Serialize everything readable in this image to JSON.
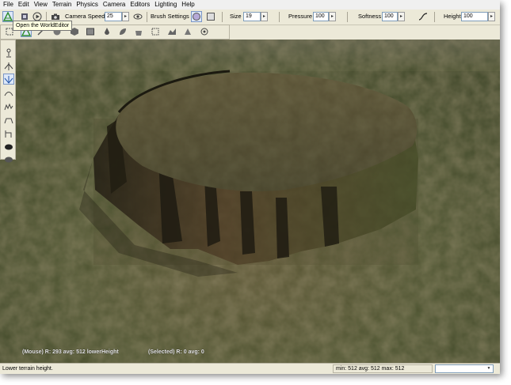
{
  "menu": [
    "File",
    "Edit",
    "View",
    "Terrain",
    "Physics",
    "Camera",
    "Editors",
    "Lighting",
    "Help"
  ],
  "toolbar": {
    "camera_speed_label": "Camera Speed",
    "camera_speed_value": "25",
    "brush_settings_label": "Brush Settings",
    "size_label": "Size",
    "size_value": "19",
    "pressure_label": "Pressure",
    "pressure_value": "100",
    "softness_label": "Softness",
    "softness_value": "100",
    "height_label": "Height",
    "height_value": "100"
  },
  "tooltip": "Open the WorldEditor",
  "viewport": {
    "mouse_info": "(Mouse) R: 293  avg: 512  lowerHeight",
    "selected_info": "(Selected) R: 0  avg: 0"
  },
  "status": {
    "message": "Lower terrain height.",
    "stats": "min: 512  avg: 512  max: 512",
    "dropdown_value": ""
  },
  "colors": {
    "chrome": "#ece9d8",
    "accent": "#7a96c6",
    "terrain_grass": "#4f5a30",
    "terrain_dirt": "#6e5a3c"
  },
  "icons": {
    "toolbar1": [
      "world-editor-icon",
      "gui-editor-icon",
      "play-icon",
      "camera-icon",
      "visibility-icon",
      "brush-circle-icon",
      "brush-box-icon",
      "falloff-curve-icon"
    ],
    "toolbar2": [
      "select-icon",
      "terrain-editor-icon",
      "paint-icon",
      "sphere-icon",
      "cube-icon",
      "image-icon",
      "drop-icon",
      "leaf-icon",
      "bucket-icon",
      "selection-box-icon",
      "terrain-select-icon",
      "light-icon",
      "object-icon"
    ],
    "vertical": [
      "grab-icon",
      "raise-icon",
      "lower-icon",
      "smooth-icon",
      "noise-icon",
      "flatten-icon",
      "set-height-icon",
      "clear-icon",
      "empty-icon"
    ]
  }
}
